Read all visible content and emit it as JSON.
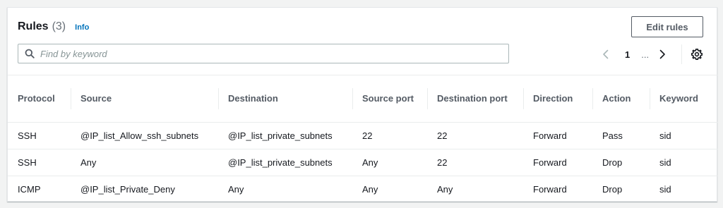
{
  "header": {
    "title": "Rules",
    "count": "(3)",
    "info_label": "Info",
    "edit_button": "Edit rules"
  },
  "search": {
    "placeholder": "Find by keyword",
    "value": ""
  },
  "pagination": {
    "current_page": "1",
    "ellipsis": "..."
  },
  "table": {
    "columns": [
      "Protocol",
      "Source",
      "Destination",
      "Source port",
      "Destination port",
      "Direction",
      "Action",
      "Keyword"
    ],
    "rows": [
      [
        "SSH",
        "@IP_list_Allow_ssh_subnets",
        "@IP_list_private_subnets",
        "22",
        "22",
        "Forward",
        "Pass",
        "sid"
      ],
      [
        "SSH",
        "Any",
        "@IP_list_private_subnets",
        "Any",
        "22",
        "Forward",
        "Drop",
        "sid"
      ],
      [
        "ICMP",
        "@IP_list_Private_Deny",
        "Any",
        "Any",
        "Any",
        "Forward",
        "Drop",
        "sid"
      ]
    ]
  },
  "icons": {
    "search": "search-icon",
    "prev": "chevron-left-icon",
    "next": "chevron-right-icon",
    "settings": "gear-icon"
  },
  "colors": {
    "link": "#0073bb",
    "text": "#16191f",
    "muted": "#545b64",
    "border": "#eaeded"
  }
}
